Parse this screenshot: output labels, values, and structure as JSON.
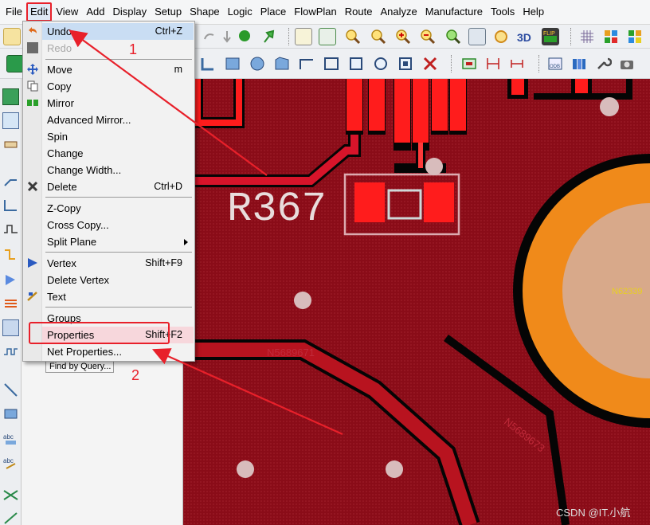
{
  "menubar": {
    "items": [
      "File",
      "Edit",
      "View",
      "Add",
      "Display",
      "Setup",
      "Shape",
      "Logic",
      "Place",
      "FlowPlan",
      "Route",
      "Analyze",
      "Manufacture",
      "Tools",
      "Help"
    ]
  },
  "edit_menu": {
    "items": [
      {
        "label": "Undo",
        "shortcut": "Ctrl+Z",
        "icon": "undo-icon"
      },
      {
        "label": "Redo",
        "shortcut": "",
        "icon": "redo-icon"
      },
      {
        "label": "Move",
        "shortcut": "m",
        "icon": "move-icon"
      },
      {
        "label": "Copy",
        "shortcut": "",
        "icon": "copy-icon"
      },
      {
        "label": "Mirror",
        "shortcut": "",
        "icon": "mirror-icon"
      },
      {
        "label": "Advanced Mirror...",
        "shortcut": ""
      },
      {
        "label": "Spin",
        "shortcut": ""
      },
      {
        "label": "Change",
        "shortcut": ""
      },
      {
        "label": "Change Width...",
        "shortcut": ""
      },
      {
        "label": "Delete",
        "shortcut": "Ctrl+D",
        "icon": "delete-icon"
      },
      {
        "label": "Z-Copy",
        "shortcut": ""
      },
      {
        "label": "Cross Copy...",
        "shortcut": ""
      },
      {
        "label": "Split Plane",
        "shortcut": ""
      },
      {
        "label": "Vertex",
        "shortcut": "Shift+F9",
        "icon": "vertex-icon"
      },
      {
        "label": "Delete Vertex",
        "shortcut": ""
      },
      {
        "label": "Text",
        "shortcut": "",
        "icon": "text-icon"
      },
      {
        "label": "Groups",
        "shortcut": ""
      },
      {
        "label": "Properties",
        "shortcut": "Shift+F2"
      },
      {
        "label": "Net Properties...",
        "shortcut": ""
      }
    ]
  },
  "panel": {
    "find_by_query": "Find by Query..."
  },
  "canvas": {
    "refdes_label": "R367",
    "net_label_1": "N62339",
    "net_label_2": "N5689671",
    "net_label_3": "N5689673"
  },
  "annotations": {
    "step1": "1",
    "step2": "2"
  },
  "watermark": "CSDN @IT.小航",
  "colors": {
    "board": "#8a0c18",
    "copper": "#ff1c1c",
    "pad_ring": "#f08a1a",
    "annotation": "#e8202a"
  }
}
